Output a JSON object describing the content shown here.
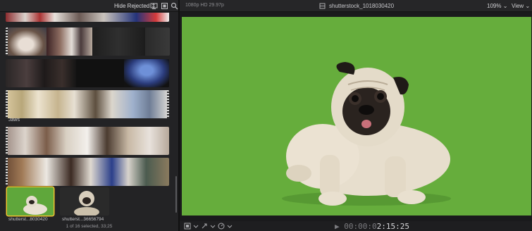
{
  "browser": {
    "filter_label": "Hide Rejected ⇕",
    "clip_label": "Jaws",
    "clips": [
      {
        "name": "shutterst...8030420",
        "selected": true
      },
      {
        "name": "shutterst...36656794",
        "selected": false
      }
    ],
    "status": "1 of 16 selected, 33;25",
    "icons": [
      "clip-appearance-icon",
      "filmstrip-icon",
      "search-icon"
    ]
  },
  "viewer": {
    "format": "1080p HD 29.97p",
    "clip_title": "shutterstock_1018030420",
    "zoom": "109%",
    "zoom_chevron": "⌄",
    "view_menu": "View",
    "timecode_dim": "▶ 00:00:0",
    "timecode_lit": "2:15:25",
    "icons": [
      "film-icon",
      "transform-icon",
      "speed-icon"
    ]
  },
  "colors": {
    "green_screen": "#66ad3c",
    "selection": "#f2c230",
    "panel": "#232325"
  }
}
